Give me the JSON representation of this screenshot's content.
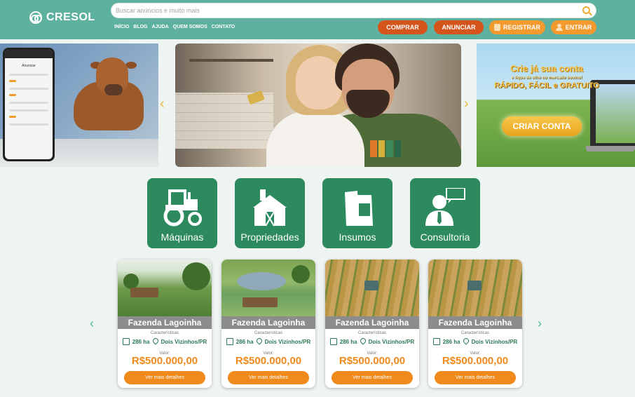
{
  "brand": {
    "name": "CRESOL"
  },
  "search": {
    "placeholder": "Buscar anúncios e muito mais"
  },
  "nav": [
    "INÍCIO",
    "BLOG",
    "AJUDA",
    "QUEM SOMOS",
    "CONTATO"
  ],
  "header_buttons": {
    "comprar": "COMPRAR",
    "anunciar": "ANUNCIAR",
    "registrar": "REGISTRAR",
    "entrar": "ENTRAR"
  },
  "phone_mockup": {
    "title": "Anunciar"
  },
  "promo": {
    "headline": "Crie já sua conta",
    "subline": "e fique de olho no mercado bovino!",
    "tagline": "RÁPIDO, FÁCIL e GRATUITO",
    "button": "CRIAR CONTA"
  },
  "carousel": {
    "prev_icon": "chevron-left-icon",
    "next_icon": "chevron-right-icon"
  },
  "categories": [
    {
      "label": "Máquinas",
      "icon": "tractor-icon"
    },
    {
      "label": "Propriedades",
      "icon": "barn-icon"
    },
    {
      "label": "Insumos",
      "icon": "feed-bag-icon"
    },
    {
      "label": "Consultoria",
      "icon": "consultant-icon"
    }
  ],
  "listings": [
    {
      "title": "Fazenda Lagoinha",
      "subtitle": "Características",
      "area": "286 ha",
      "location": "Dois Vizinhos/PR",
      "value_label": "Valor:",
      "price": "R$500.000,00",
      "button": "Ver mais detalhes"
    },
    {
      "title": "Fazenda Lagoinha",
      "subtitle": "Características",
      "area": "286 ha",
      "location": "Dois Vizinhos/PR",
      "value_label": "Valor:",
      "price": "R$500.000,00",
      "button": "Ver mais detalhes"
    },
    {
      "title": "Fazenda Lagoinha",
      "subtitle": "Características",
      "area": "286 ha",
      "location": "Dois Vizinhos/PR",
      "value_label": "Valor:",
      "price": "R$500.000,00",
      "button": "Ver mais detalhes"
    },
    {
      "title": "Fazenda Lagoinha",
      "subtitle": "Características",
      "area": "286 ha",
      "location": "Dois Vizinhos/PR",
      "value_label": "Valor:",
      "price": "R$500.000,00",
      "button": "Ver mais detalhes"
    }
  ],
  "colors": {
    "header": "#5fb19f",
    "category": "#2d8a5e",
    "accent": "#f08a1c",
    "dark_orange": "#d4541c"
  }
}
